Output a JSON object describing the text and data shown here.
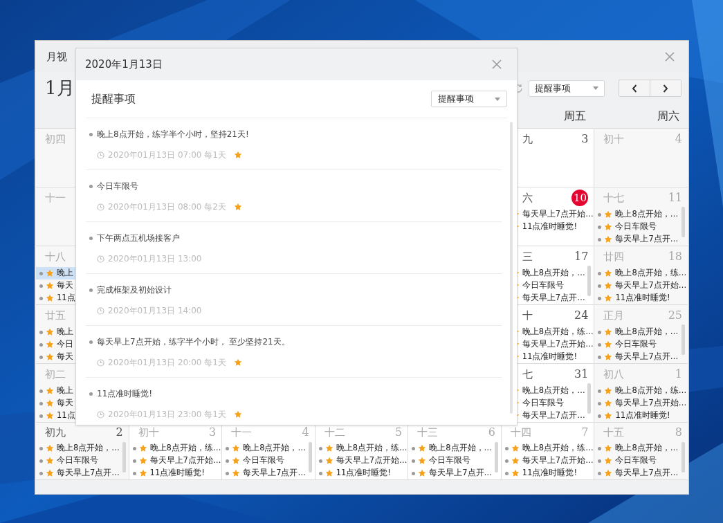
{
  "window": {
    "title": "月视",
    "toolbar": {
      "date": "1月",
      "filter": "提醒事项"
    },
    "weekdays": [
      {
        "label": "周五"
      },
      {
        "label": "周六"
      }
    ],
    "weeks": [
      {
        "cells": [
          {
            "lunar": "初四",
            "muted": true
          },
          {},
          {},
          {},
          {},
          {
            "lunar": "九",
            "day": "3",
            "muted": false,
            "today": false
          },
          {
            "lunar": "初十",
            "day": "4",
            "muted": true,
            "today": false
          }
        ]
      },
      {
        "cells": [
          {
            "lunar": "十一",
            "muted": true
          },
          {},
          {},
          {},
          {},
          {
            "lunar": "六",
            "day": "10",
            "muted": false,
            "today": true,
            "events": [
              {
                "text": "每天早上7点开始…",
                "selected": false
              },
              {
                "text": "11点准时睡觉!",
                "selected": false
              }
            ]
          },
          {
            "lunar": "十七",
            "day": "11",
            "muted": true,
            "today": false,
            "scroll": true,
            "events": [
              {
                "text": "晚上8点开始，…",
                "selected": false
              },
              {
                "text": "今日车限号",
                "selected": false
              },
              {
                "text": "每天早上7点开…",
                "selected": false
              }
            ]
          }
        ]
      },
      {
        "cells": [
          {
            "lunar": "十八",
            "muted": true,
            "events": [
              {
                "text": "晚上",
                "selected": true
              },
              {
                "text": "每天",
                "selected": false
              },
              {
                "text": "11点",
                "selected": false
              }
            ]
          },
          {},
          {},
          {},
          {},
          {
            "lunar": "三",
            "day": "17",
            "muted": false,
            "today": false,
            "scroll": true,
            "events": [
              {
                "text": "晚上8点开始，…",
                "selected": false
              },
              {
                "text": "今日车限号",
                "selected": false
              },
              {
                "text": "每天早上7点开…",
                "selected": false
              }
            ]
          },
          {
            "lunar": "廿四",
            "day": "18",
            "muted": true,
            "today": false,
            "events": [
              {
                "text": "晚上8点开始，练…",
                "selected": false
              },
              {
                "text": "每天早上7点开始…",
                "selected": false
              },
              {
                "text": "11点准时睡觉!",
                "selected": false
              }
            ]
          }
        ]
      },
      {
        "cells": [
          {
            "lunar": "廿五",
            "muted": true,
            "events": [
              {
                "text": "晚上",
                "selected": false
              },
              {
                "text": "今日",
                "selected": false
              },
              {
                "text": "每天",
                "selected": false
              }
            ]
          },
          {},
          {},
          {},
          {},
          {
            "lunar": "十",
            "day": "24",
            "muted": false,
            "today": false,
            "events": [
              {
                "text": "晚上8点开始，练…",
                "selected": false
              },
              {
                "text": "每天早上7点开始…",
                "selected": false
              },
              {
                "text": "11点准时睡觉!",
                "selected": false
              }
            ]
          },
          {
            "lunar": "正月",
            "day": "25",
            "muted": true,
            "today": false,
            "scroll": true,
            "events": [
              {
                "text": "晚上8点开始，…",
                "selected": false
              },
              {
                "text": "今日车限号",
                "selected": false
              },
              {
                "text": "每天早上7点开…",
                "selected": false
              }
            ]
          }
        ]
      },
      {
        "cells": [
          {
            "lunar": "初二",
            "muted": true,
            "events": [
              {
                "text": "晚上",
                "selected": false
              },
              {
                "text": "每天",
                "selected": false
              },
              {
                "text": "11点",
                "selected": false
              }
            ]
          },
          {},
          {},
          {},
          {},
          {
            "lunar": "七",
            "day": "31",
            "muted": false,
            "today": false,
            "scroll": true,
            "events": [
              {
                "text": "晚上8点开始，…",
                "selected": false
              },
              {
                "text": "今日车限号",
                "selected": false
              },
              {
                "text": "每天早上7点开…",
                "selected": false
              }
            ]
          },
          {
            "lunar": "初八",
            "day": "1",
            "muted": true,
            "today": false,
            "events": [
              {
                "text": "晚上8点开始，练…",
                "selected": false
              },
              {
                "text": "每天早上7点开始…",
                "selected": false
              },
              {
                "text": "11点准时睡觉!",
                "selected": false
              }
            ]
          }
        ]
      },
      {
        "cells": [
          {
            "lunar": "初九",
            "day": "2",
            "muted": false,
            "today": false,
            "scroll": true,
            "events": [
              {
                "text": "晚上8点开始，…",
                "selected": false
              },
              {
                "text": "今日车限号",
                "selected": false
              },
              {
                "text": "每天早上7点开…",
                "selected": false
              }
            ]
          },
          {
            "lunar": "初十",
            "day": "3",
            "muted": true,
            "today": false,
            "events": [
              {
                "text": "晚上8点开始，练…",
                "selected": false
              },
              {
                "text": "每天早上7点开始…",
                "selected": false
              },
              {
                "text": "11点准时睡觉!",
                "selected": false
              }
            ]
          },
          {
            "lunar": "十一",
            "day": "4",
            "muted": true,
            "today": false,
            "scroll": true,
            "events": [
              {
                "text": "晚上8点开始，…",
                "selected": false
              },
              {
                "text": "今日车限号",
                "selected": false
              },
              {
                "text": "每天早上7点开…",
                "selected": false
              }
            ]
          },
          {
            "lunar": "十二",
            "day": "5",
            "muted": true,
            "today": false,
            "events": [
              {
                "text": "晚上8点开始，练…",
                "selected": false
              },
              {
                "text": "每天早上7点开始…",
                "selected": false
              },
              {
                "text": "11点准时睡觉!",
                "selected": false
              }
            ]
          },
          {
            "lunar": "十三",
            "day": "6",
            "muted": true,
            "today": false,
            "scroll": true,
            "events": [
              {
                "text": "晚上8点开始，…",
                "selected": false
              },
              {
                "text": "今日车限号",
                "selected": false
              },
              {
                "text": "每天早上7点开…",
                "selected": false
              }
            ]
          },
          {
            "lunar": "十四",
            "day": "7",
            "muted": true,
            "today": false,
            "events": [
              {
                "text": "晚上8点开始，练…",
                "selected": false
              },
              {
                "text": "每天早上7点开始…",
                "selected": false
              },
              {
                "text": "11点准时睡觉!",
                "selected": false
              }
            ]
          },
          {
            "lunar": "十五",
            "day": "8",
            "muted": true,
            "today": false,
            "scroll": true,
            "events": [
              {
                "text": "晚上8点开始，…",
                "selected": false
              },
              {
                "text": "今日车限号",
                "selected": false
              },
              {
                "text": "每天早上7点开…",
                "selected": false
              }
            ]
          }
        ]
      }
    ]
  },
  "dialog": {
    "title": "2020年1月13日",
    "heading": "提醒事项",
    "filter": "提醒事项",
    "reminders": [
      {
        "title": "晚上8点开始，练字半个小时，坚持21天!",
        "time": "2020年01月13日 07:00 每1天",
        "starred": true
      },
      {
        "title": "今日车限号",
        "time": "2020年01月13日 08:00 每2天",
        "starred": true
      },
      {
        "title": "下午两点五机场接客户",
        "time": "2020年01月13日 13:00",
        "starred": false
      },
      {
        "title": "完成框架及初始设计",
        "time": "2020年01月13日 14:00",
        "starred": false
      },
      {
        "title": "每天早上7点开始，练字半个小时， 至少坚持21天。",
        "time": "2020年01月13日 20:00 每1天",
        "starred": true
      },
      {
        "title": "11点准时睡觉!",
        "time": "2020年01月13日 23:00 每1天",
        "starred": true
      }
    ]
  }
}
